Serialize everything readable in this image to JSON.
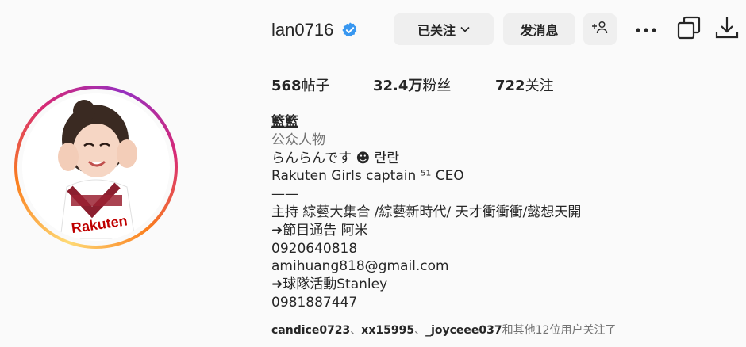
{
  "profile": {
    "username": "lan0716",
    "verified": true,
    "full_name": "籃籃",
    "category": "公众人物"
  },
  "buttons": {
    "following_label": "已关注",
    "message_label": "发消息"
  },
  "icons": {
    "verified": "verified-badge-icon",
    "following_chevron": "chevron-down-icon",
    "add_user": "add-user-icon",
    "more": "more-options-icon",
    "copy": "copy-icon",
    "download": "download-icon"
  },
  "stats": {
    "posts_count": "568",
    "posts_label": "帖子",
    "followers_count": "32.4万",
    "followers_label": "粉丝",
    "following_count": "722",
    "following_label": "关注"
  },
  "bio": {
    "lines": [
      "らんらんです ☻ 란란",
      "Rakuten Girls captain ⁵¹ CEO",
      "——",
      "主持 綜藝大集合 /綜藝新時代/ 天才衝衝衝/懿想天開",
      "➜節目通告 阿米",
      "0920640818",
      "amihuang818@gmail.com",
      "➜球隊活動Stanley",
      "0981887447"
    ]
  },
  "followed_by": {
    "users": [
      "candice0723",
      "xx15995",
      "_joyceee037"
    ],
    "separator": "、",
    "suffix": "和其他12位用户关注了"
  },
  "colors": {
    "background": "#fafafa",
    "button_bg": "#efefef",
    "verified_blue": "#3897f0",
    "text_primary": "#262626",
    "text_secondary": "#737373"
  }
}
